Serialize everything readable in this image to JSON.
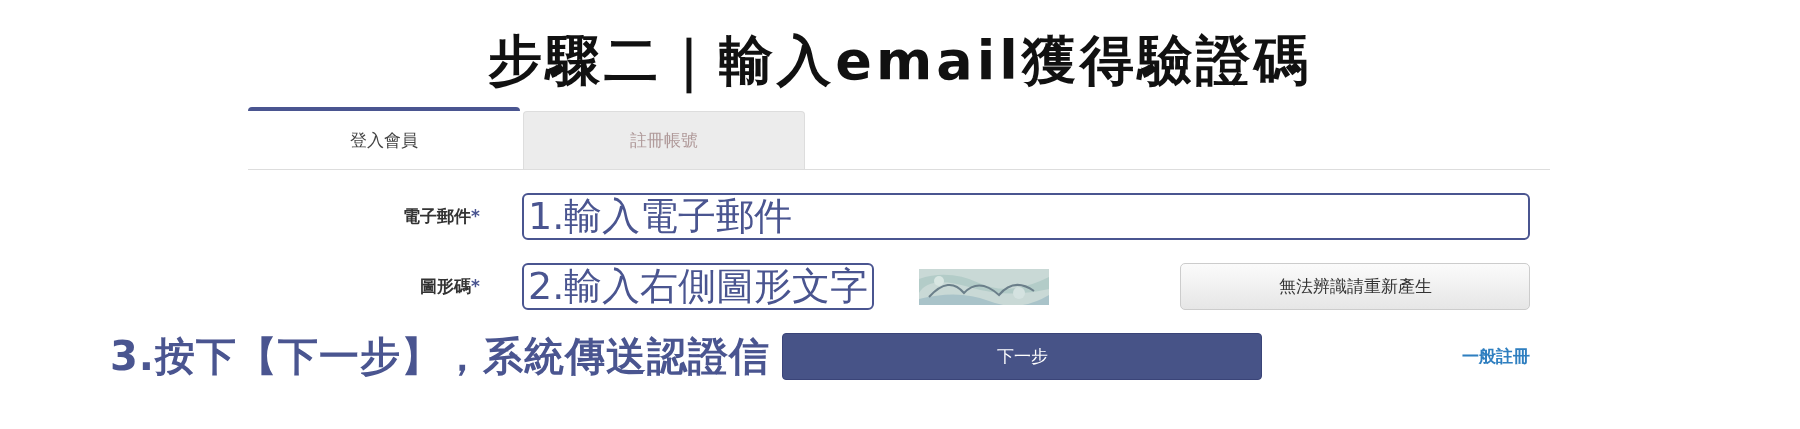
{
  "title": "步驟二｜輸入email獲得驗證碼",
  "tabs": [
    {
      "label": "登入會員",
      "selected": true
    },
    {
      "label": "註冊帳號",
      "selected": false
    }
  ],
  "fields": [
    {
      "kind": "email",
      "label": "電子郵件",
      "required": "*",
      "annotation": "1.輸入電子郵件"
    },
    {
      "kind": "captcha",
      "label": "圖形碼",
      "required": "*",
      "annotation": "2.輸入右側圖形文字",
      "captcha_button": "無法辨識請重新產生"
    }
  ],
  "step3_annotation": "3.按下【下一步】，系統傳送認證信",
  "submit_button": "下一步",
  "register_link": "一般註冊"
}
